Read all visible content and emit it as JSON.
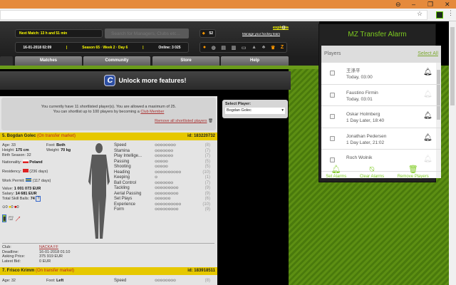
{
  "window": {
    "minimize": "–",
    "restore": "❐",
    "close": "✕",
    "account": "⊖"
  },
  "header": {
    "next_match": "Next Match: 13 h and 51 min",
    "search_placeholder": "Search for Managers, Clubs etc...",
    "date": "16-01-2018 02:09",
    "season": "Season 65 · Week 2 · Day 6",
    "online": "Online: 3 025",
    "coins": "52",
    "username": "explosia",
    "manage": "Manage your hockey team"
  },
  "nav": {
    "tabs": [
      "Matches",
      "Community",
      "Store",
      "Help"
    ]
  },
  "unlock": "Unlock more features!",
  "notice": {
    "line1": "You currently have 11 shortlisted player(s). You are allowed a maximum of 25.",
    "line2_prefix": "You can shortlist up to 100 players by becoming a ",
    "club_member": "Club Member",
    "remove_all": "Remove all shortlisted players"
  },
  "select_player": {
    "label": "Select Player:",
    "value": "Bogdan Golec"
  },
  "players": [
    {
      "name": "5. Bogdan Golec",
      "status": "(On transfer market)",
      "id": "id: 183220732",
      "age": "Age: 33",
      "foot_label": "Foot: ",
      "foot": "Both",
      "height_label": "Height: ",
      "height": "175 cm",
      "weight_label": "Weight: ",
      "weight": "70 kg",
      "birth": "Birth Season: 32",
      "nationality_label": "Nationality: ",
      "nationality": "Poland",
      "residency": "Residency: ",
      "residency_days": "(236 days)",
      "permit": "Work Permit: ",
      "permit_days": "(117 days)",
      "value_label": "Value: ",
      "value": "1 001 073 EUR",
      "salary_label": "Salary: ",
      "salary": "14 681 EUR",
      "tsb_label": "Total Skill Balls: ",
      "tsb": "74",
      "cards": [
        "0",
        "0",
        "0"
      ],
      "skills": [
        {
          "name": "Speed",
          "v": 8
        },
        {
          "name": "Stamina",
          "v": 7
        },
        {
          "name": "Play Intellige...",
          "v": 7
        },
        {
          "name": "Passing",
          "v": 5
        },
        {
          "name": "Shooting",
          "v": 5
        },
        {
          "name": "Heading",
          "v": 10
        },
        {
          "name": "Keeping",
          "v": 1
        },
        {
          "name": "Ball Control",
          "v": 7
        },
        {
          "name": "Tackling",
          "v": 9
        },
        {
          "name": "Aerial Passing",
          "v": 9
        },
        {
          "name": "Set Plays",
          "v": 6
        },
        {
          "name": "Experience",
          "v": 10
        },
        {
          "name": "Form",
          "v": 9
        }
      ],
      "club_label": "Club:",
      "club": "NACKA FF",
      "deadline_label": "Deadline:",
      "deadline": "16-01-2018 01:10",
      "asking_label": "Asking Price:",
      "asking": "375 919 EUR",
      "bid_label": "Latest Bid:",
      "bid": "0 EUR"
    },
    {
      "name": "7. Frisco Krimm",
      "status": "(On transfer market)",
      "id": "id: 183918511",
      "age": "Age: 32",
      "foot_label": "Foot: ",
      "foot": "Left",
      "skill1": "Speed",
      "skill1_v": "(8)"
    }
  ],
  "popup": {
    "title": "MZ Transfer Alarm",
    "players_label": "Players",
    "select_all": "Select All",
    "items": [
      {
        "name": "王涤平",
        "time": "Today, 03:00",
        "alarm": true
      },
      {
        "name": "Faustino Firmin",
        "time": "Today, 03:01",
        "alarm": false
      },
      {
        "name": "Oskar Holmberg",
        "time": "1 Day Later, 18:40",
        "alarm": true
      },
      {
        "name": "Jonathan Pedersen",
        "time": "1 Day Later, 21:02",
        "alarm": true
      },
      {
        "name": "Roch Wolnik",
        "time": "",
        "alarm": false
      }
    ],
    "actions": [
      "Set Alarms",
      "Clear Alarms",
      "Remove Players"
    ]
  },
  "colors": {
    "accent": "#7ecb20",
    "highlight": "#e6c800",
    "titlebar": "#e58a3c"
  }
}
